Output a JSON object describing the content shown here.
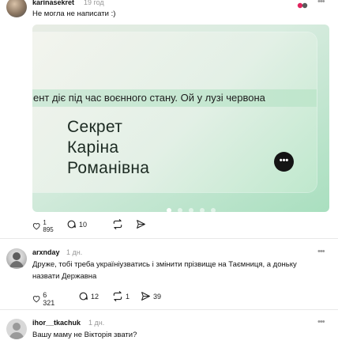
{
  "post1": {
    "username": "karinasekret",
    "time": "19 год",
    "text": "Не могла не написати :)",
    "card": {
      "marquee": "ент діє під час воєнного стану. Ой у лузі червона",
      "name_lines": [
        "Секрет",
        "Каріна",
        "Романівна"
      ],
      "more_label": "•••",
      "slide_count": 5,
      "active_slide": 1
    },
    "likes": "1 895",
    "comments": "10"
  },
  "post2": {
    "username": "arxnday",
    "time": "1 дн.",
    "text_line1": "Друже, тобі треба україніузватись і змінити прізвище на Таємниця, а доньку",
    "text_line2": "назвати Державна",
    "likes": "6 321",
    "comments": "12",
    "reposts": "1",
    "shares": "39",
    "more_label": "•••"
  },
  "post3": {
    "username": "ihor__tkachuk",
    "time": "1 дн.",
    "text": "Вашу маму не Вікторія звати?",
    "more_label": "•••"
  },
  "colors": {
    "accent_red": "#e0245e",
    "username": "#111111",
    "muted": "#999999"
  }
}
